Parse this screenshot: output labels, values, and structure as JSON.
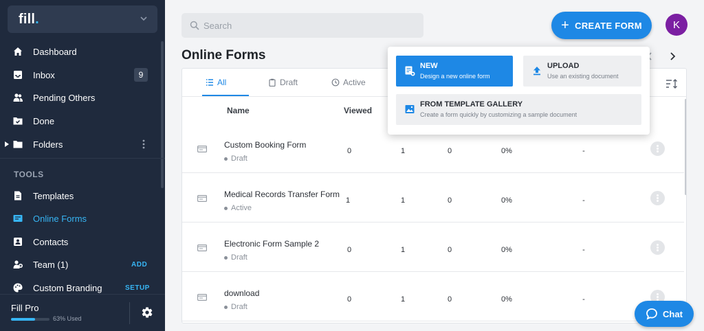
{
  "brand": {
    "logo_text": "fill",
    "logo_dot": "."
  },
  "sidebar": {
    "items": [
      {
        "label": "Dashboard",
        "icon": "home-icon"
      },
      {
        "label": "Inbox",
        "icon": "inbox-icon",
        "badge": "9"
      },
      {
        "label": "Pending Others",
        "icon": "users-icon"
      },
      {
        "label": "Done",
        "icon": "folder-check-icon"
      },
      {
        "label": "Folders",
        "icon": "folder-icon"
      }
    ],
    "tools_label": "TOOLS",
    "tools": [
      {
        "label": "Templates",
        "icon": "document-icon"
      },
      {
        "label": "Online Forms",
        "icon": "form-icon",
        "active": true
      },
      {
        "label": "Contacts",
        "icon": "contact-card-icon"
      },
      {
        "label": "Team (1)",
        "icon": "team-icon",
        "action": "ADD"
      },
      {
        "label": "Custom Branding",
        "icon": "palette-icon",
        "action": "SETUP"
      }
    ],
    "plan": {
      "name": "Fill Pro",
      "usage_text": "63% Used",
      "usage_percent": 63
    }
  },
  "search": {
    "placeholder": "Search"
  },
  "create_button": {
    "label": "CREATE FORM"
  },
  "avatar": {
    "initial": "K",
    "color": "#7b1fa2"
  },
  "page": {
    "title": "Online Forms"
  },
  "tabs": [
    {
      "label": "All",
      "icon": "list-icon"
    },
    {
      "label": "Draft",
      "icon": "clipboard-icon"
    },
    {
      "label": "Active",
      "icon": "clock-icon"
    }
  ],
  "table": {
    "columns": [
      "Name",
      "Viewed"
    ],
    "rows": [
      {
        "name": "Custom Booking Form",
        "status": "Draft",
        "viewed": "0",
        "c2": "1",
        "c3": "0",
        "c4": "0%",
        "c5": "-"
      },
      {
        "name": "Medical Records Transfer Form",
        "status": "Active",
        "viewed": "1",
        "c2": "1",
        "c3": "0",
        "c4": "0%",
        "c5": "-"
      },
      {
        "name": "Electronic Form Sample 2",
        "status": "Draft",
        "viewed": "0",
        "c2": "1",
        "c3": "0",
        "c4": "0%",
        "c5": "-"
      },
      {
        "name": "download",
        "status": "Draft",
        "viewed": "0",
        "c2": "1",
        "c3": "0",
        "c4": "0%",
        "c5": "-"
      }
    ]
  },
  "dropdown": {
    "new": {
      "title": "NEW",
      "subtitle": "Design a new online form"
    },
    "upload": {
      "title": "UPLOAD",
      "subtitle": "Use an existing document"
    },
    "gallery": {
      "title": "FROM TEMPLATE GALLERY",
      "subtitle": "Create a form quickly by customizing a sample document"
    }
  },
  "chat": {
    "label": "Chat"
  },
  "colors": {
    "accent": "#1e88e5",
    "sidebar_bg": "#1f2a3d",
    "active_link": "#37b5f4"
  }
}
